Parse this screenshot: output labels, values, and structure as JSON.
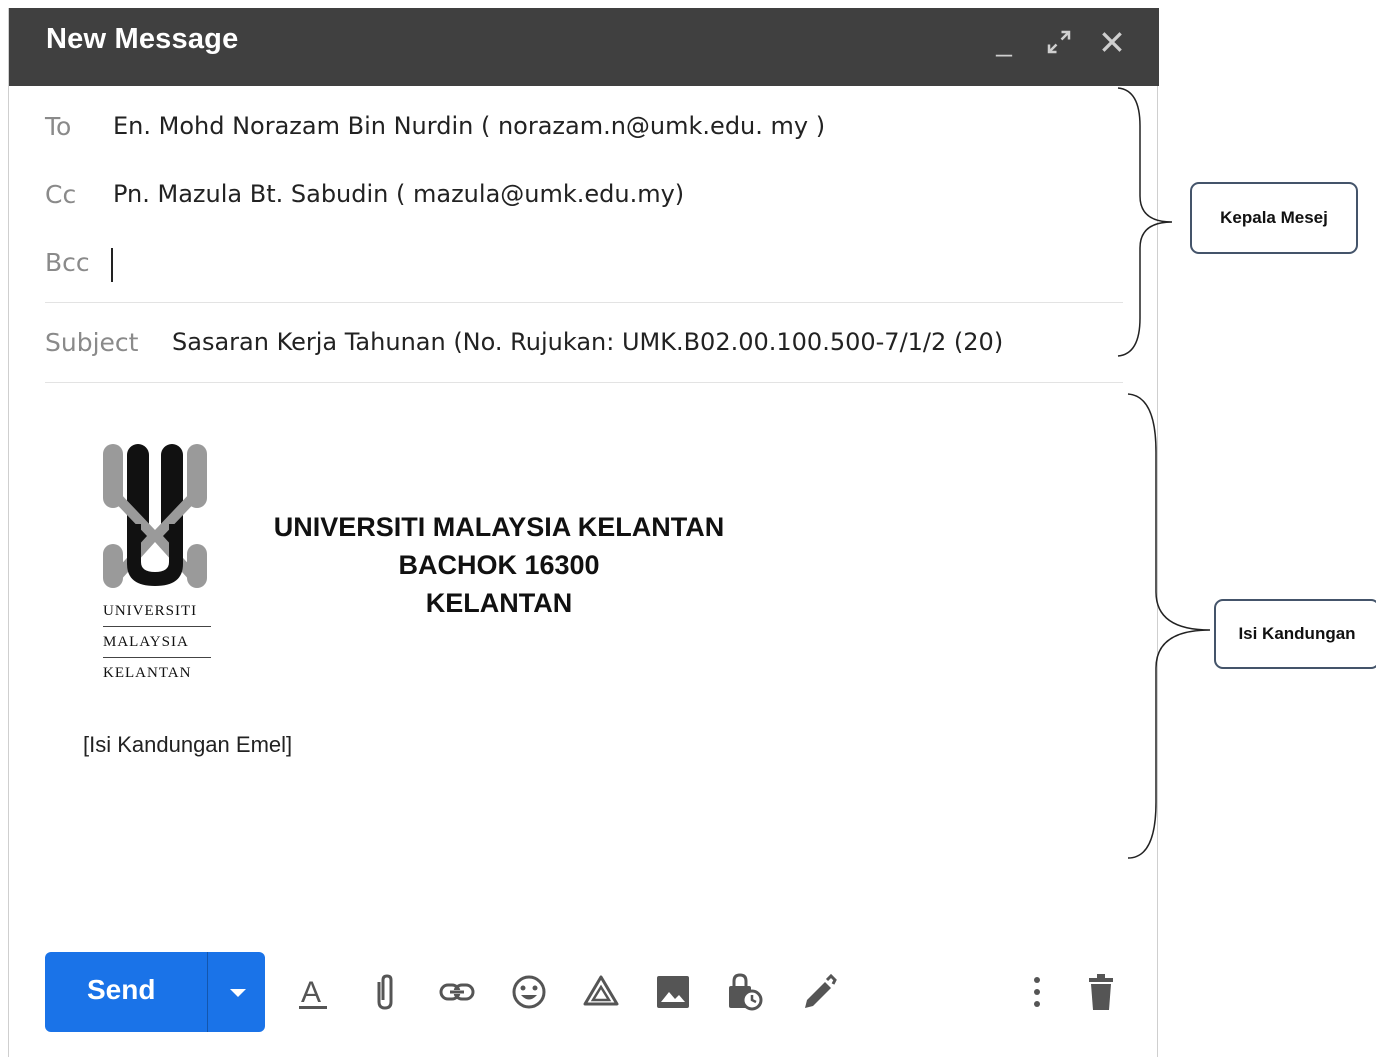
{
  "window": {
    "title": "New Message",
    "controls": {
      "minimize": "_",
      "expand": "⤢",
      "close": "✕"
    }
  },
  "fields": {
    "to_label": "To",
    "to_value": "En. Mohd Norazam Bin Nurdin ( norazam.n@umk.edu. my )",
    "cc_label": "Cc",
    "cc_value": "Pn. Mazula Bt. Sabudin ( mazula@umk.edu.my)",
    "bcc_label": "Bcc",
    "bcc_value": "",
    "subject_label": "Subject",
    "subject_value": "Sasaran Kerja Tahunan (No. Rujukan: UMK.B02.00.100.500-7/1/2 (20)"
  },
  "letterhead": {
    "line1": "UNIVERSITI MALAYSIA KELANTAN",
    "line2": "BACHOK 16300",
    "line3": "KELANTAN",
    "logo_words": [
      "UNIVERSITI",
      "MALAYSIA",
      "KELANTAN"
    ]
  },
  "body": {
    "text": "[Isi Kandungan Emel]"
  },
  "toolbar": {
    "send_label": "Send",
    "icons": [
      "text-format-icon",
      "attach-icon",
      "link-icon",
      "emoji-icon",
      "drive-icon",
      "photo-icon",
      "confidential-icon",
      "signature-icon",
      "more-options-icon",
      "discard-icon"
    ]
  },
  "annotations": {
    "header_label": "Kepala Mesej",
    "body_label": "Isi Kandungan"
  },
  "colors": {
    "titlebar": "#404040",
    "send": "#1a73e8",
    "callout_border": "#44546a"
  }
}
